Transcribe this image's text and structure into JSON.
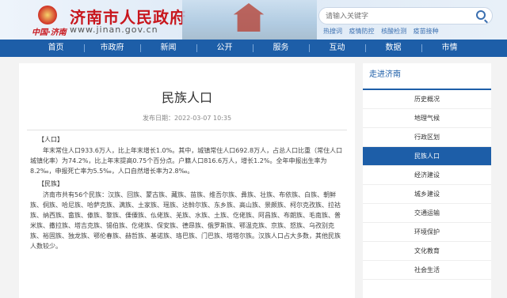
{
  "header": {
    "site_title": "济南市人民政府",
    "site_url": "www.jinan.gov.cn",
    "logo_text": "中国·济南",
    "search_placeholder": "请输入关键字",
    "hot_links": [
      "热搜词",
      "疫情防控",
      "核酸检测",
      "疫苗接种"
    ]
  },
  "nav": [
    "首页",
    "市政府",
    "新闻",
    "公开",
    "服务",
    "互动",
    "数据",
    "市情"
  ],
  "article": {
    "title": "民族人口",
    "meta": "发布日期：2022-03-07 10:35",
    "section1_head": "【人口】",
    "section1_body": "年末常住人口933.6万人，比上年末增长1.0%。其中，城镇常住人口692.8万人，占总人口比重（常住人口城镇化率）为74.2%，比上年末提高0.75个百分点。户籍人口816.6万人，增长1.2%。全年申报出生率为8.2‰，申报死亡率为5.5‰，人口自然增长率为2.8‰。",
    "section2_head": "【民族】",
    "section2_body": "济南市共有56个民族：汉族、回族、蒙古族、藏族、苗族、维吾尔族、彝族、壮族、布依族、白族、朝鲜族、侗族、哈尼族、哈萨克族、满族、土家族、瑶族、达斡尔族、东乡族、高山族、景颇族、柯尔克孜族、拉祜族、纳西族、畲族、傣族、黎族、傈僳族、仫佬族、羌族、水族、土族、仡佬族、阿昌族、布朗族、毛南族、普米族、撒拉族、塔吉克族、锡伯族、仡佬族、保安族、德昂族、俄罗斯族、鄂温克族、京族、怒族、乌孜别克族、裕固族、独龙族、鄂伦春族、赫哲族、基诺族、珞巴族、门巴族、塔塔尔族。汉族人口占大多数，其他民族人数较少。"
  },
  "sidebar": {
    "head": "走进济南",
    "items": [
      "历史概况",
      "地理气候",
      "行政区划",
      "民族人口",
      "经济建设",
      "城乡建设",
      "交通运输",
      "环境保护",
      "文化教育",
      "社会生活"
    ],
    "active_index": 3
  },
  "colors": {
    "brand_red": "#c8161d",
    "nav_blue": "#1d5ea8"
  }
}
